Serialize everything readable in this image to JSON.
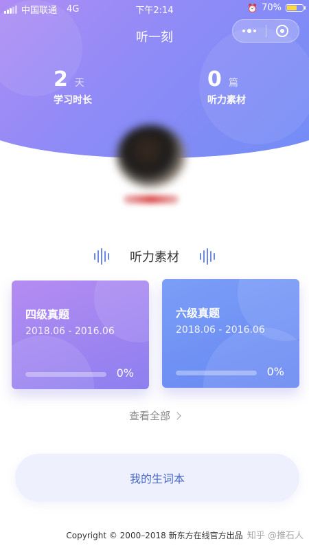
{
  "status_bar": {
    "carrier": "中国联通",
    "network": "4G",
    "time": "下午2:14",
    "battery_percent": "70%",
    "battery_level": 0.7
  },
  "header": {
    "title": "听一刻",
    "stats": [
      {
        "number": "2",
        "unit": "天",
        "label": "学习时长"
      },
      {
        "number": "0",
        "unit": "篇",
        "label": "听力素材"
      }
    ]
  },
  "section": {
    "title": "听力素材"
  },
  "cards": [
    {
      "name": "四级真题",
      "range": "2018.06 - 2016.06",
      "progress": 0,
      "progress_text": "0%",
      "color_start": "#b48cf1",
      "color_end": "#8d7ff0"
    },
    {
      "name": "六级真题",
      "range": "2018.06 - 2016.06",
      "progress": 0,
      "progress_text": "0%",
      "color_start": "#7b9ef7",
      "color_end": "#6787f2"
    }
  ],
  "view_all": {
    "label": "查看全部"
  },
  "vocab_button": {
    "label": "我的生词本"
  },
  "footer": {
    "copyright": "Copyright © 2000–2018 新东方在线官方出品",
    "watermark": "知乎 @推石人"
  },
  "icons": {
    "menu": "more-dots-icon",
    "close": "target-icon",
    "wave": "sound-wave-icon"
  },
  "colors": {
    "header_start": "#b58cf3",
    "header_end": "#6f8cf6",
    "accent": "#4a68c9"
  }
}
